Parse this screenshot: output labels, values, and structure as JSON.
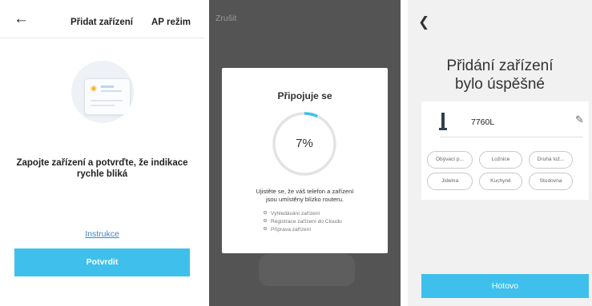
{
  "add_device_screen": {
    "back_icon": "arrow-left-icon",
    "title": "Přidat zařízení",
    "ap_mode": "AP režim",
    "illustration_icon": "device-wifi-illustration",
    "instruction_text": "Zapojte zařízení a potvrďte, že indikace rychle bliká",
    "instructions_link": "Instrukce",
    "confirm_button": "Potvrdit",
    "accent_color": "#3fc0ec"
  },
  "connecting_screen": {
    "cancel": "Zrušit",
    "dialog_title": "Připojuje se",
    "progress_label": "7%",
    "progress_fraction": 0.07,
    "info_line1": "Ujistěte se, že váš telefon a zařízení",
    "info_line2": "jsou umístěny blízko routeru.",
    "steps": [
      "Vyhledávání zařízení",
      "Registrace zařízení do Cloudu",
      "Příprava zařízení"
    ]
  },
  "success_screen": {
    "back_icon": "chevron-left-icon",
    "heading_line1": "Přidání zařízení",
    "heading_line2": "bylo úspěšné",
    "device_icon": "tower-fan-icon",
    "device_name": "7760L",
    "edit_icon": "pencil-icon",
    "rooms": [
      "Obývací p...",
      "Ložnice",
      "Druhá lož...",
      "Jídelna",
      "Kuchyně",
      "Studovna"
    ],
    "done_button": "Hotovo"
  }
}
